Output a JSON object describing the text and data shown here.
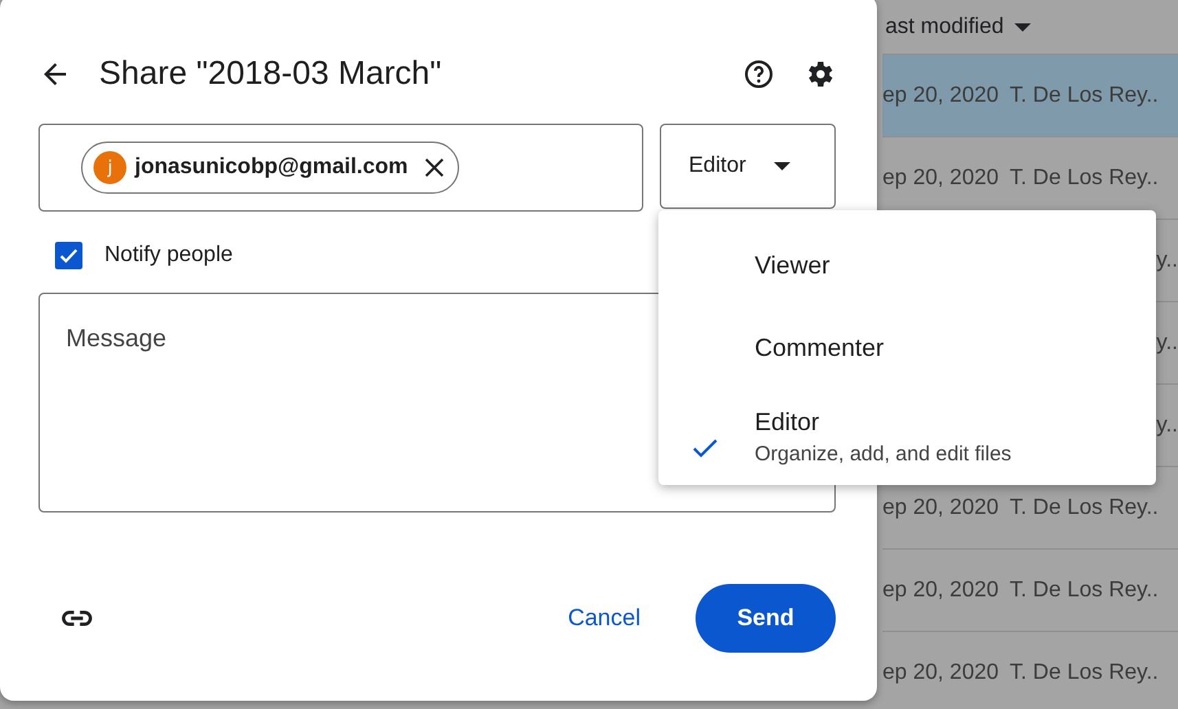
{
  "background_list": {
    "header": "ast modified",
    "rows": [
      {
        "date": "ep 20, 2020",
        "owner": "T. De Los Rey..",
        "selected": true
      },
      {
        "date": "ep 20, 2020",
        "owner": "T. De Los Rey..",
        "selected": false
      },
      {
        "date": "",
        "owner": "y..",
        "selected": false
      },
      {
        "date": "",
        "owner": "y..",
        "selected": false
      },
      {
        "date": "",
        "owner": "y..",
        "selected": false
      },
      {
        "date": "ep 20, 2020",
        "owner": "T. De Los Rey..",
        "selected": false
      },
      {
        "date": "ep 20, 2020",
        "owner": "T. De Los Rey..",
        "selected": false
      },
      {
        "date": "ep 20, 2020",
        "owner": "T. De Los Rey..",
        "selected": false
      }
    ]
  },
  "dialog": {
    "title": "Share \"2018-03 March\"",
    "recipients": [
      {
        "initial": "j",
        "email": "jonasunicobp@gmail.com",
        "color": "#e8710a"
      }
    ],
    "role": "Editor",
    "notify": {
      "label": "Notify people",
      "checked": true
    },
    "message": {
      "placeholder": "Message"
    },
    "buttons": {
      "cancel": "Cancel",
      "send": "Send"
    }
  },
  "role_menu": [
    {
      "label": "Viewer",
      "selected": false
    },
    {
      "label": "Commenter",
      "selected": false
    },
    {
      "label": "Editor",
      "description": "Organize, add, and edit files",
      "selected": true
    }
  ]
}
